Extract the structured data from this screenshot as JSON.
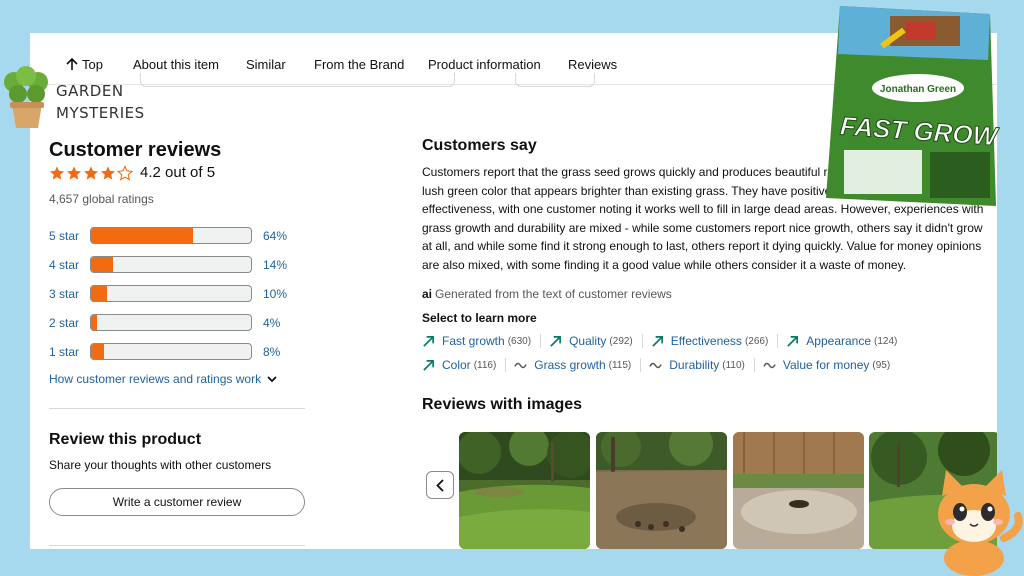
{
  "brand": {
    "line1": "GARDEN",
    "line2": "MYSTERIES"
  },
  "tabs": {
    "top": "Top",
    "about": "About this item",
    "similar": "Similar",
    "brand": "From the Brand",
    "info": "Product information",
    "reviews": "Reviews"
  },
  "reviews": {
    "heading": "Customer reviews",
    "rating_text": "4.2 out of 5",
    "rating_value": 4.2,
    "global_ratings": "4,657 global ratings",
    "histogram": [
      {
        "label": "5 star",
        "pct": "64%",
        "value": 64
      },
      {
        "label": "4 star",
        "pct": "14%",
        "value": 14
      },
      {
        "label": "3 star",
        "pct": "10%",
        "value": 10
      },
      {
        "label": "2 star",
        "pct": "4%",
        "value": 4
      },
      {
        "label": "1 star",
        "pct": "8%",
        "value": 8
      }
    ],
    "how_link": "How customer reviews and ratings work"
  },
  "review_product": {
    "heading": "Review this product",
    "subtext": "Share your thoughts with other customers",
    "button": "Write a customer review"
  },
  "customers_say": {
    "heading": "Customers say",
    "summary": "Customers report that the grass seed grows quickly and produces beautiful results within two months, with lush green color that appears brighter than existing grass. They have positive feedback for its quality and effectiveness, with one customer noting it works well to fill in large dead areas. However, experiences with grass growth and durability are mixed - while some customers report nice growth, others say it didn't grow at all, and while some find it strong enough to last, others report it dying quickly. Value for money opinions are also mixed, with some finding it a good value while others consider it a waste of money.",
    "ai_note": "Generated from the text of customer reviews",
    "ai_mark": "ai",
    "select_label": "Select to learn more",
    "chips_row1": [
      {
        "label": "Fast growth",
        "count": "(630)",
        "icon": "trend-up-icon"
      },
      {
        "label": "Quality",
        "count": "(292)",
        "icon": "trend-up-icon"
      },
      {
        "label": "Effectiveness",
        "count": "(266)",
        "icon": "trend-up-icon"
      },
      {
        "label": "Appearance",
        "count": "(124)",
        "icon": "trend-up-icon"
      }
    ],
    "chips_row2": [
      {
        "label": "Color",
        "count": "(116)",
        "icon": "trend-up-icon"
      },
      {
        "label": "Grass growth",
        "count": "(115)",
        "icon": "mixed-icon"
      },
      {
        "label": "Durability",
        "count": "(110)",
        "icon": "mixed-icon"
      },
      {
        "label": "Value for money",
        "count": "(95)",
        "icon": "mixed-icon"
      }
    ]
  },
  "images_section": {
    "heading": "Reviews with images"
  },
  "product_bag": {
    "brand": "Jonathan Green",
    "name": "FAST GROW"
  },
  "colors": {
    "background": "#a6d8ee",
    "star": "#f26b10",
    "bar_fill": "#f26b10",
    "link": "#2162a1",
    "trend": "#067d62"
  }
}
